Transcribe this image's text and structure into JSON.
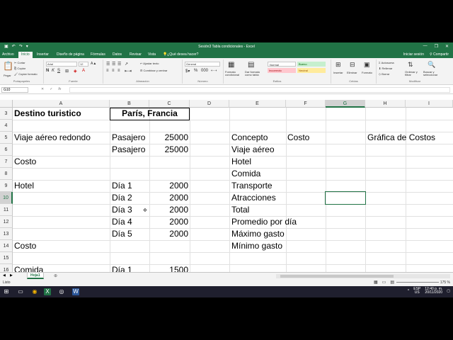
{
  "window": {
    "title": "Sesión3 Tabla condicionales - Excel",
    "controls": [
      "—",
      "❐",
      "✕"
    ]
  },
  "tabs": [
    {
      "label": "Archivo"
    },
    {
      "label": "Inicio",
      "active": true
    },
    {
      "label": "Insertar"
    },
    {
      "label": "Diseño de página"
    },
    {
      "label": "Fórmulas"
    },
    {
      "label": "Datos"
    },
    {
      "label": "Revisar"
    },
    {
      "label": "Vista"
    },
    {
      "label": "¿Qué desea hacer?"
    }
  ],
  "account": {
    "signin": "Iniciar sesión",
    "share": "Compartir"
  },
  "ribbon": {
    "clipboard": {
      "paste": "Pegar",
      "cut": "Cortar",
      "copy": "Copiar",
      "format": "Copiar formato",
      "label": "Portapapeles"
    },
    "font": {
      "name": "Arial",
      "size": "12",
      "label": "Fuente"
    },
    "alignment": {
      "wrap": "Ajustar texto",
      "merge": "Combinar y centrar",
      "label": "Alineación"
    },
    "number": {
      "format": "General",
      "label": "Número"
    },
    "styles": {
      "conditional": "Formato condicional",
      "table": "Dar formato como tabla",
      "normal": "Normal",
      "good": "Bueno",
      "bad": "Incorrecto",
      "neutral": "Neutral",
      "label": "Estilos",
      "good_bg": "#c6efce",
      "good_fg": "#006100",
      "bad_bg": "#ffc7ce",
      "bad_fg": "#9c0006",
      "neutral_bg": "#ffeb9c",
      "neutral_fg": "#9c5700"
    },
    "cells": {
      "insert": "Insertar",
      "delete": "Eliminar",
      "format": "Formato",
      "label": "Celdas"
    },
    "editing": {
      "autosum": "Autosuma",
      "fill": "Rellenar",
      "clear": "Borrar",
      "sort": "Ordenar y filtrar",
      "find": "Buscar y seleccionar",
      "label": "Modificar"
    }
  },
  "formula_bar": {
    "name_box": "G10",
    "fx": "fx",
    "value": ""
  },
  "columns": [
    "A",
    "B",
    "C",
    "D",
    "E",
    "F",
    "G",
    "H",
    "I"
  ],
  "selected_column": "G",
  "rows": [
    "3",
    "4",
    "5",
    "6",
    "7",
    "8",
    "9",
    "10",
    "11",
    "12",
    "13",
    "14",
    "15",
    "16"
  ],
  "selected_row": "10",
  "cells": {
    "r3": {
      "A": "Destino turistico",
      "B": "París, Francia"
    },
    "r5": {
      "A": "Viaje aéreo redondo",
      "B": "Pasajero",
      "C": "25000",
      "E": "Concepto",
      "F": "Costo",
      "H": "Gráfica de Costos"
    },
    "r6": {
      "B": "Pasajero",
      "C": "25000",
      "E": "Viaje aéreo"
    },
    "r7": {
      "A": "Costo",
      "E": "Hotel"
    },
    "r8": {
      "E": "Comida"
    },
    "r9": {
      "A": "Hotel",
      "B": "Día 1",
      "C": "2000",
      "E": "Transporte"
    },
    "r10": {
      "B": "Día 2",
      "C": "2000",
      "E": "Atracciones"
    },
    "r11": {
      "B": "Día 3",
      "C": "2000",
      "E": "Total"
    },
    "r12": {
      "B": "Día 4",
      "C": "2000",
      "E": "Promedio por día"
    },
    "r13": {
      "B": "Día 5",
      "C": "2000",
      "E": "Máximo gasto"
    },
    "r14": {
      "A": "Costo",
      "E": "Mínimo gasto"
    },
    "r16": {
      "A": "Comida",
      "B": "Día 1",
      "C": "1500"
    }
  },
  "sheets": [
    {
      "label": "Hoja1",
      "active": true
    }
  ],
  "add_sheet": "⊕",
  "status": {
    "mode": "Listo",
    "zoom": "175 %"
  },
  "taskbar": {
    "lang": "ESP",
    "region": "US",
    "time": "12:40 p. m.",
    "date": "20/11/2020"
  },
  "accent_color": "#217346"
}
